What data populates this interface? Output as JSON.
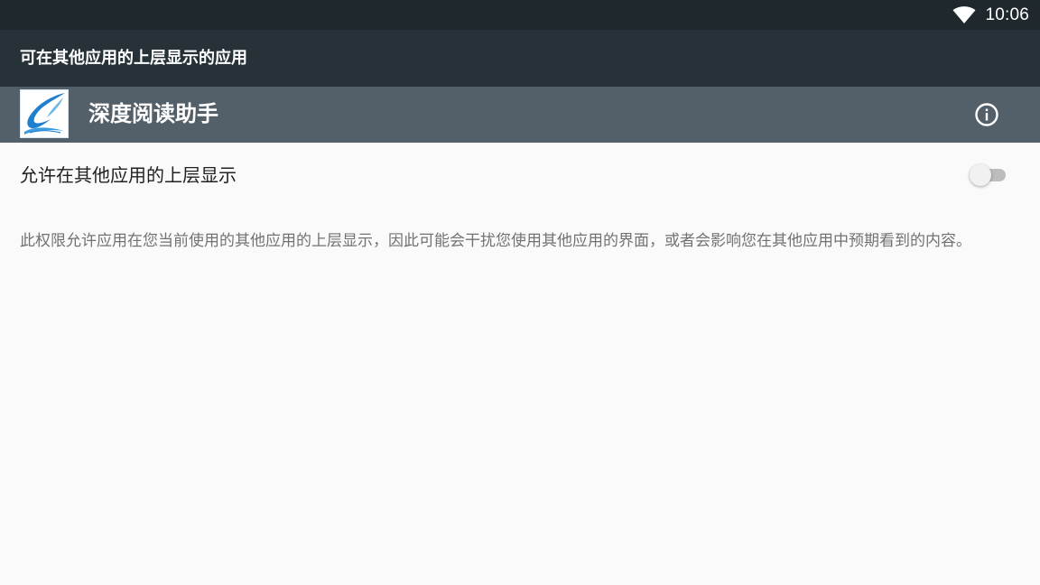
{
  "status_bar": {
    "time": "10:06",
    "icons": [
      "wifi-icon"
    ]
  },
  "action_bar": {
    "title": "可在其他应用的上层显示的应用"
  },
  "app_header": {
    "app_name": "深度阅读助手",
    "icons": [
      "app-logo-icon",
      "info-icon"
    ]
  },
  "preference": {
    "title": "允许在其他应用的上层显示",
    "switch_on": false,
    "summary": "此权限允许应用在您当前使用的其他应用的上层显示，因此可能会干扰您使用其他应用的界面，或者会影响您在其他应用中预期看到的内容。"
  },
  "colors": {
    "status_bar": "#1f282d",
    "action_bar": "#263238",
    "app_header": "#546069",
    "background": "#fafafa"
  }
}
